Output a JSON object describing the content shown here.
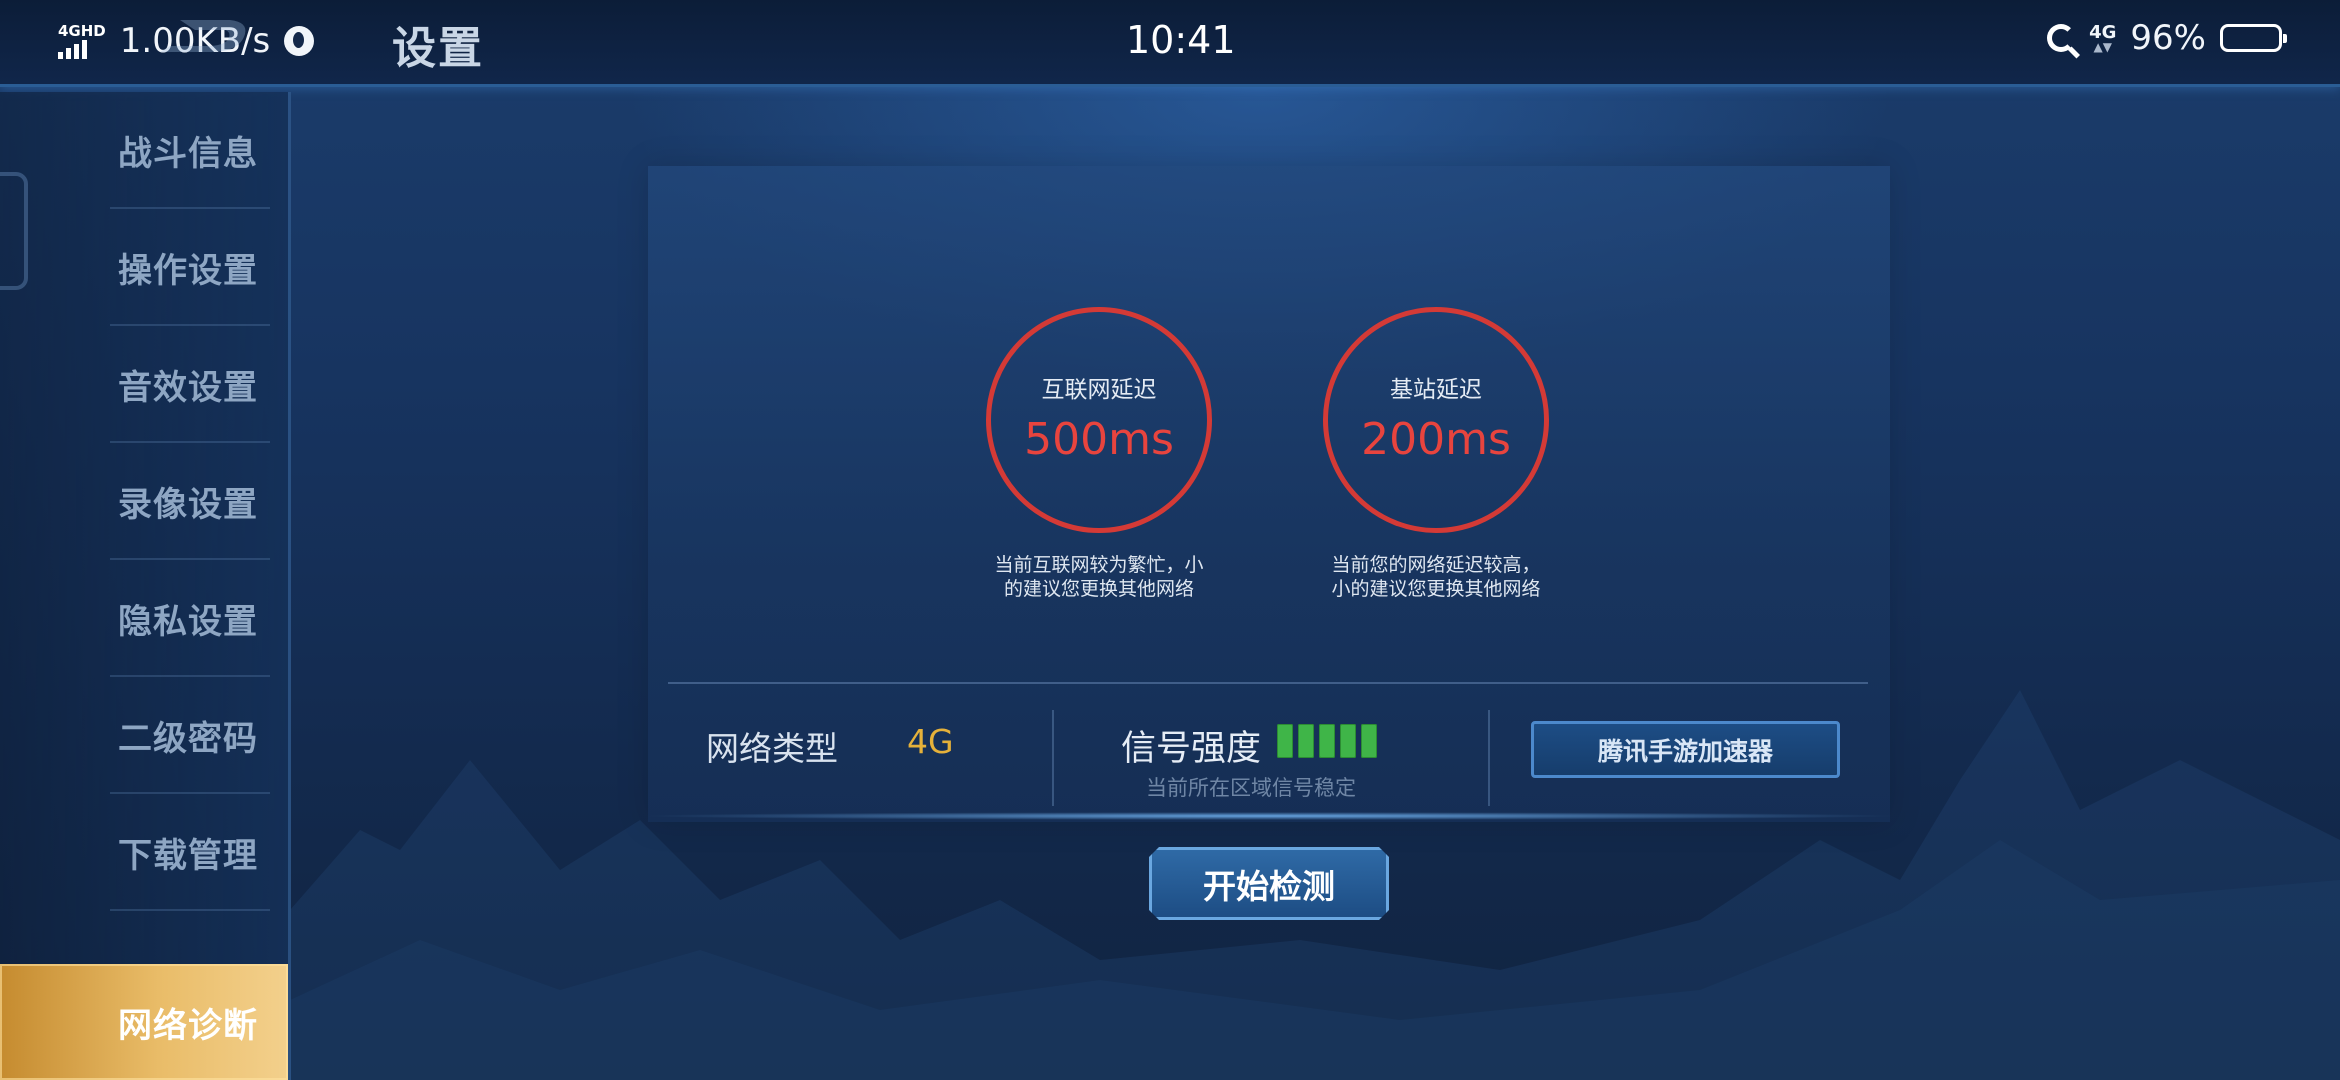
{
  "status_bar": {
    "network_tag": "4GHD",
    "speed": "1.00KB/s",
    "time": "10:41",
    "right_network": "4G",
    "battery": "96%"
  },
  "header": {
    "title": "设置"
  },
  "sidebar": {
    "items": [
      {
        "label": "战斗信息",
        "active": false
      },
      {
        "label": "操作设置",
        "active": false
      },
      {
        "label": "音效设置",
        "active": false
      },
      {
        "label": "录像设置",
        "active": false
      },
      {
        "label": "隐私设置",
        "active": false
      },
      {
        "label": "二级密码",
        "active": false
      },
      {
        "label": "下载管理",
        "active": false
      },
      {
        "label": "网络诊断",
        "active": true
      }
    ]
  },
  "diagnostics": {
    "internet": {
      "label": "互联网延迟",
      "value": "500ms",
      "advice_line1": "当前互联网较为繁忙，小",
      "advice_line2": "的建议您更换其他网络"
    },
    "base_station": {
      "label": "基站延迟",
      "value": "200ms",
      "advice_line1": "当前您的网络延迟较高，",
      "advice_line2": "小的建议您更换其他网络"
    },
    "network_type_label": "网络类型",
    "network_type_value": "4G",
    "signal_label": "信号强度",
    "signal_level": 1.0,
    "signal_bars": 5,
    "signal_status": "当前所在区域信号稳定",
    "accelerator_button": "腾讯手游加速器",
    "start_button": "开始检测"
  },
  "colors": {
    "alert_red": "#e8443e",
    "network_value_gold": "#e5b13a",
    "signal_green": "#3fb548",
    "active_tab_gold": "#e9bc68"
  }
}
